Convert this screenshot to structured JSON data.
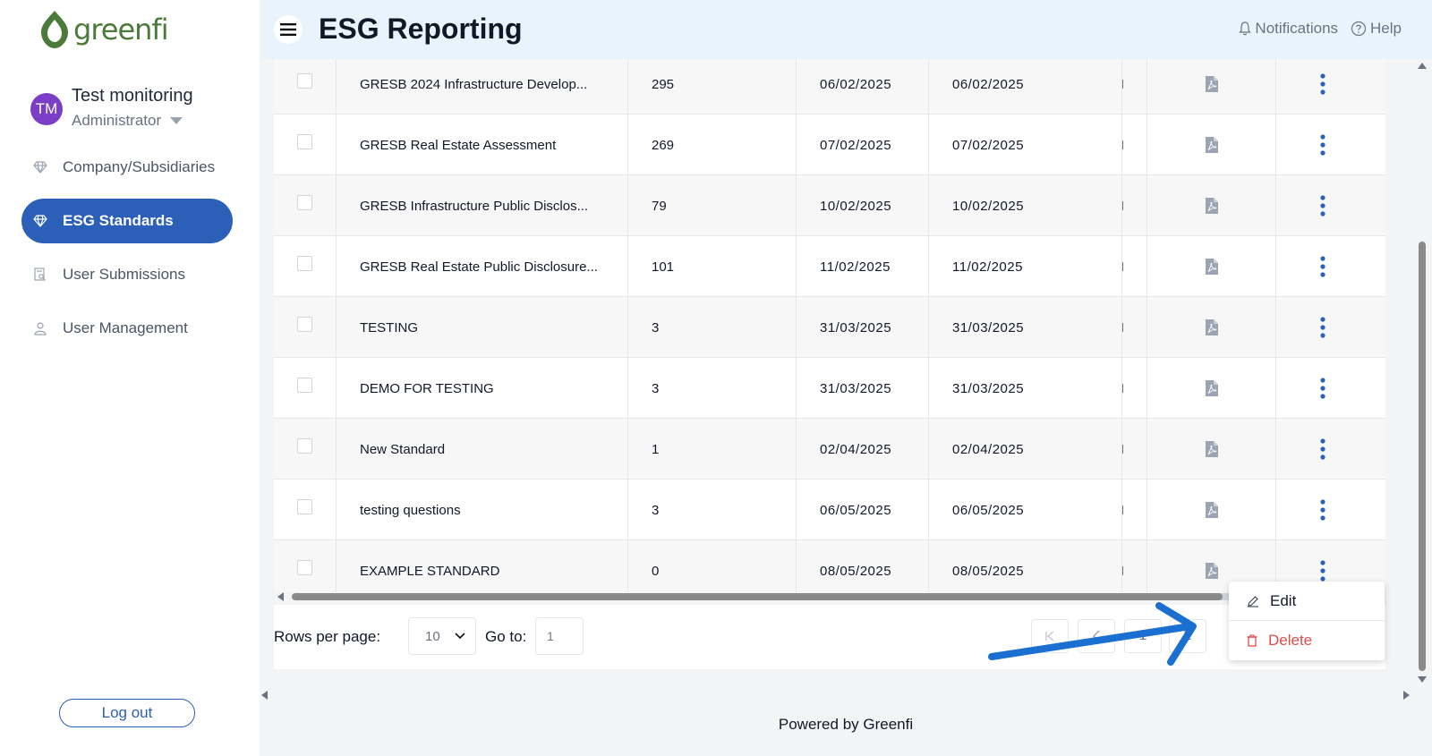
{
  "app": {
    "logo_text": "greenfi",
    "brand_color": "#2b5fb8",
    "accent_green": "#4b7a3a"
  },
  "user": {
    "initials": "TM",
    "name": "Test monitoring",
    "role": "Administrator"
  },
  "sidebar": {
    "items": [
      {
        "label": "Company/Subsidiaries",
        "icon": "diamond-icon",
        "active": false
      },
      {
        "label": "ESG Standards",
        "icon": "diamond-icon",
        "active": true
      },
      {
        "label": "User Submissions",
        "icon": "document-search-icon",
        "active": false
      },
      {
        "label": "User Management",
        "icon": "user-icon",
        "active": false
      }
    ],
    "logout_label": "Log out"
  },
  "header": {
    "title": "ESG Reporting",
    "notifications_label": "Notifications",
    "help_label": "Help"
  },
  "table": {
    "rows": [
      {
        "name": "GRESB 2024 Infrastructure Develop...",
        "count": "295",
        "created": "06/02/2025",
        "updated": "06/02/2025"
      },
      {
        "name": "GRESB Real Estate Assessment",
        "count": "269",
        "created": "07/02/2025",
        "updated": "07/02/2025"
      },
      {
        "name": "GRESB Infrastructure Public Disclos...",
        "count": "79",
        "created": "10/02/2025",
        "updated": "10/02/2025"
      },
      {
        "name": "GRESB Real Estate Public Disclosure...",
        "count": "101",
        "created": "11/02/2025",
        "updated": "11/02/2025"
      },
      {
        "name": "TESTING",
        "count": "3",
        "created": "31/03/2025",
        "updated": "31/03/2025"
      },
      {
        "name": "DEMO FOR TESTING",
        "count": "3",
        "created": "31/03/2025",
        "updated": "31/03/2025"
      },
      {
        "name": "New Standard",
        "count": "1",
        "created": "02/04/2025",
        "updated": "02/04/2025"
      },
      {
        "name": "testing questions",
        "count": "3",
        "created": "06/05/2025",
        "updated": "06/05/2025"
      },
      {
        "name": "EXAMPLE STANDARD",
        "count": "0",
        "created": "08/05/2025",
        "updated": "08/05/2025"
      }
    ]
  },
  "pagination": {
    "rows_per_page_label": "Rows per page:",
    "rows_per_page_value": "10",
    "goto_label": "Go to:",
    "goto_placeholder": "1",
    "pages": [
      "1",
      "2"
    ]
  },
  "row_menu": {
    "edit_label": "Edit",
    "delete_label": "Delete"
  },
  "footer": {
    "powered_by": "Powered by Greenfi"
  }
}
